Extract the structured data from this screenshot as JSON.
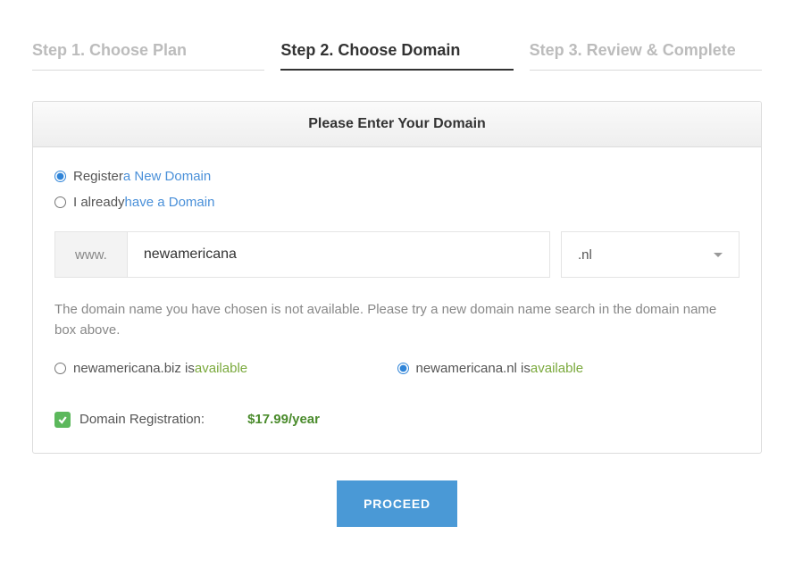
{
  "tabs": {
    "step1": "Step 1. Choose Plan",
    "step2": "Step 2. Choose Domain",
    "step3": "Step 3. Review & Complete"
  },
  "panel_title": "Please Enter Your Domain",
  "domain_mode": {
    "register_prefix": "Register ",
    "register_link": "a New Domain",
    "have_prefix": "I already ",
    "have_link": "have a Domain"
  },
  "input": {
    "prefix": "www.",
    "value": "newamericana",
    "tld": ".nl"
  },
  "unavailable_msg": "The domain name you have chosen is not available. Please try a new domain name search in the domain name box above.",
  "available": {
    "opt1_name": "newamericana.biz is ",
    "opt1_status": "available",
    "opt2_name": "newamericana.nl is ",
    "opt2_status": "available"
  },
  "registration": {
    "label": "Domain Registration:",
    "price": "$17.99/year"
  },
  "proceed_label": "PROCEED"
}
